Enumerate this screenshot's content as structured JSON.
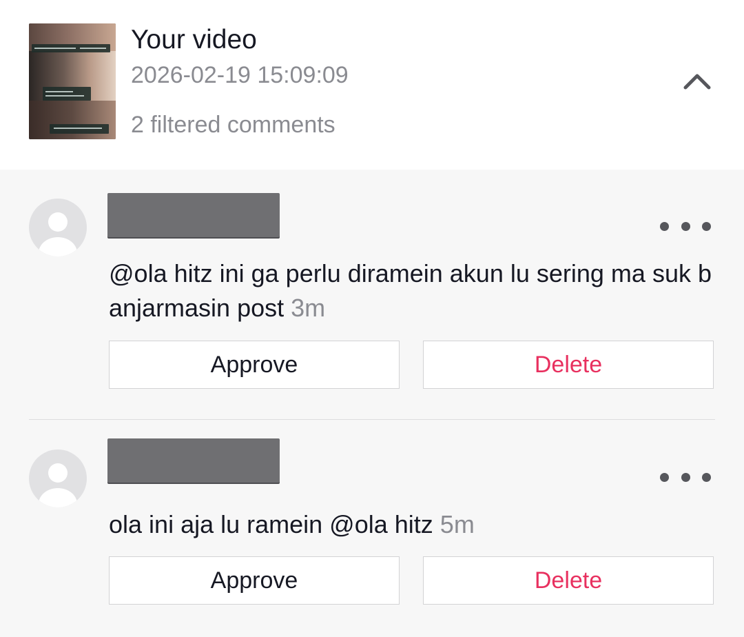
{
  "video": {
    "title": "Your video",
    "timestamp": "2026-02-19 15:09:09",
    "filtered_count_text": "2 filtered comments",
    "thumbnail_icon": "video-thumbnail"
  },
  "icons": {
    "collapse": "chevron-up-icon",
    "more": "more-horizontal-icon",
    "avatar": "default-avatar-icon"
  },
  "colors": {
    "delete": "#e8305f",
    "secondary_text": "#8a8b91",
    "background": "#f7f7f7"
  },
  "comments": [
    {
      "username": "",
      "username_redacted": true,
      "text": "@ola hitz ini ga perlu diramein akun lu sering ma suk banjarmasin post",
      "time": "3m",
      "approve_label": "Approve",
      "delete_label": "Delete"
    },
    {
      "username": "",
      "username_redacted": true,
      "text": "ola ini aja lu ramein @ola hitz",
      "time": "5m",
      "approve_label": "Approve",
      "delete_label": "Delete"
    }
  ]
}
